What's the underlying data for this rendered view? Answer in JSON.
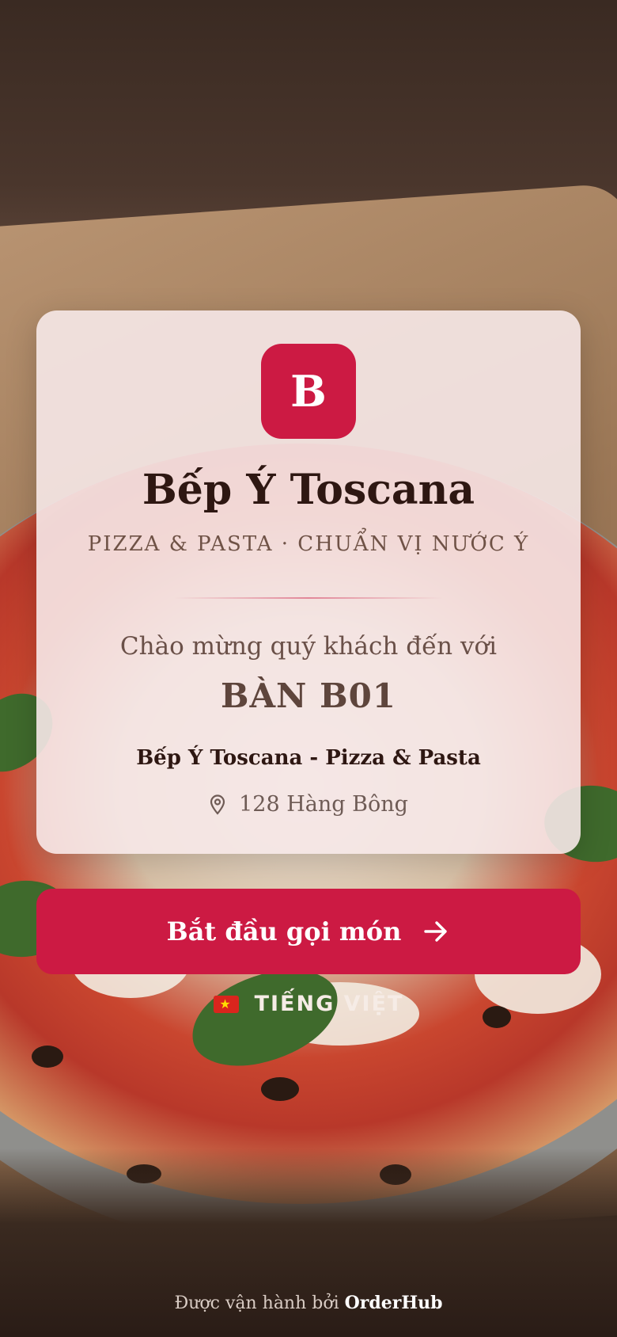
{
  "restaurant": {
    "logo_letter": "B",
    "name": "Bếp Ý Toscana",
    "tagline": "PIZZA & PASTA · CHUẨN VỊ NƯỚC Ý"
  },
  "welcome": {
    "greeting": "Chào mừng quý khách đến với",
    "table_label": "BÀN B01",
    "branch_name": "Bếp Ý Toscana - Pizza & Pasta",
    "address": "128 Hàng Bông",
    "address_icon": "map-pin-icon"
  },
  "actions": {
    "start_label": "Bắt đầu gọi món",
    "start_icon": "arrow-right-icon"
  },
  "language": {
    "flag": "🇻🇳",
    "label": "TIẾNG VIỆT"
  },
  "footer": {
    "prefix": "Được vận hành bởi",
    "brand": "OrderHub"
  },
  "colors": {
    "accent": "#cc1a43",
    "card_bg": "#f6e8e8",
    "text_dark": "#2e1712"
  }
}
